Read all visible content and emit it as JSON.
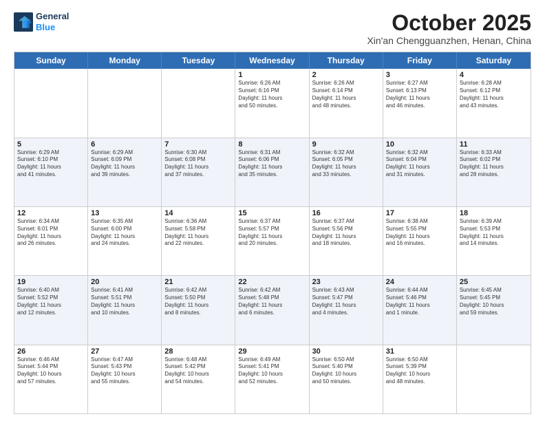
{
  "header": {
    "logo_line1": "General",
    "logo_line2": "Blue",
    "month": "October 2025",
    "location": "Xin'an Chengguanzhen, Henan, China"
  },
  "weekdays": [
    "Sunday",
    "Monday",
    "Tuesday",
    "Wednesday",
    "Thursday",
    "Friday",
    "Saturday"
  ],
  "rows": [
    [
      {
        "day": "",
        "text": ""
      },
      {
        "day": "",
        "text": ""
      },
      {
        "day": "",
        "text": ""
      },
      {
        "day": "1",
        "text": "Sunrise: 6:26 AM\nSunset: 6:16 PM\nDaylight: 11 hours\nand 50 minutes."
      },
      {
        "day": "2",
        "text": "Sunrise: 6:26 AM\nSunset: 6:14 PM\nDaylight: 11 hours\nand 48 minutes."
      },
      {
        "day": "3",
        "text": "Sunrise: 6:27 AM\nSunset: 6:13 PM\nDaylight: 11 hours\nand 46 minutes."
      },
      {
        "day": "4",
        "text": "Sunrise: 6:28 AM\nSunset: 6:12 PM\nDaylight: 11 hours\nand 43 minutes."
      }
    ],
    [
      {
        "day": "5",
        "text": "Sunrise: 6:29 AM\nSunset: 6:10 PM\nDaylight: 11 hours\nand 41 minutes."
      },
      {
        "day": "6",
        "text": "Sunrise: 6:29 AM\nSunset: 6:09 PM\nDaylight: 11 hours\nand 39 minutes."
      },
      {
        "day": "7",
        "text": "Sunrise: 6:30 AM\nSunset: 6:08 PM\nDaylight: 11 hours\nand 37 minutes."
      },
      {
        "day": "8",
        "text": "Sunrise: 6:31 AM\nSunset: 6:06 PM\nDaylight: 11 hours\nand 35 minutes."
      },
      {
        "day": "9",
        "text": "Sunrise: 6:32 AM\nSunset: 6:05 PM\nDaylight: 11 hours\nand 33 minutes."
      },
      {
        "day": "10",
        "text": "Sunrise: 6:32 AM\nSunset: 6:04 PM\nDaylight: 11 hours\nand 31 minutes."
      },
      {
        "day": "11",
        "text": "Sunrise: 6:33 AM\nSunset: 6:02 PM\nDaylight: 11 hours\nand 28 minutes."
      }
    ],
    [
      {
        "day": "12",
        "text": "Sunrise: 6:34 AM\nSunset: 6:01 PM\nDaylight: 11 hours\nand 26 minutes."
      },
      {
        "day": "13",
        "text": "Sunrise: 6:35 AM\nSunset: 6:00 PM\nDaylight: 11 hours\nand 24 minutes."
      },
      {
        "day": "14",
        "text": "Sunrise: 6:36 AM\nSunset: 5:58 PM\nDaylight: 11 hours\nand 22 minutes."
      },
      {
        "day": "15",
        "text": "Sunrise: 6:37 AM\nSunset: 5:57 PM\nDaylight: 11 hours\nand 20 minutes."
      },
      {
        "day": "16",
        "text": "Sunrise: 6:37 AM\nSunset: 5:56 PM\nDaylight: 11 hours\nand 18 minutes."
      },
      {
        "day": "17",
        "text": "Sunrise: 6:38 AM\nSunset: 5:55 PM\nDaylight: 11 hours\nand 16 minutes."
      },
      {
        "day": "18",
        "text": "Sunrise: 6:39 AM\nSunset: 5:53 PM\nDaylight: 11 hours\nand 14 minutes."
      }
    ],
    [
      {
        "day": "19",
        "text": "Sunrise: 6:40 AM\nSunset: 5:52 PM\nDaylight: 11 hours\nand 12 minutes."
      },
      {
        "day": "20",
        "text": "Sunrise: 6:41 AM\nSunset: 5:51 PM\nDaylight: 11 hours\nand 10 minutes."
      },
      {
        "day": "21",
        "text": "Sunrise: 6:42 AM\nSunset: 5:50 PM\nDaylight: 11 hours\nand 8 minutes."
      },
      {
        "day": "22",
        "text": "Sunrise: 6:42 AM\nSunset: 5:48 PM\nDaylight: 11 hours\nand 6 minutes."
      },
      {
        "day": "23",
        "text": "Sunrise: 6:43 AM\nSunset: 5:47 PM\nDaylight: 11 hours\nand 4 minutes."
      },
      {
        "day": "24",
        "text": "Sunrise: 6:44 AM\nSunset: 5:46 PM\nDaylight: 11 hours\nand 1 minute."
      },
      {
        "day": "25",
        "text": "Sunrise: 6:45 AM\nSunset: 5:45 PM\nDaylight: 10 hours\nand 59 minutes."
      }
    ],
    [
      {
        "day": "26",
        "text": "Sunrise: 6:46 AM\nSunset: 5:44 PM\nDaylight: 10 hours\nand 57 minutes."
      },
      {
        "day": "27",
        "text": "Sunrise: 6:47 AM\nSunset: 5:43 PM\nDaylight: 10 hours\nand 55 minutes."
      },
      {
        "day": "28",
        "text": "Sunrise: 6:48 AM\nSunset: 5:42 PM\nDaylight: 10 hours\nand 54 minutes."
      },
      {
        "day": "29",
        "text": "Sunrise: 6:49 AM\nSunset: 5:41 PM\nDaylight: 10 hours\nand 52 minutes."
      },
      {
        "day": "30",
        "text": "Sunrise: 6:50 AM\nSunset: 5:40 PM\nDaylight: 10 hours\nand 50 minutes."
      },
      {
        "day": "31",
        "text": "Sunrise: 6:50 AM\nSunset: 5:39 PM\nDaylight: 10 hours\nand 48 minutes."
      },
      {
        "day": "",
        "text": ""
      }
    ]
  ]
}
